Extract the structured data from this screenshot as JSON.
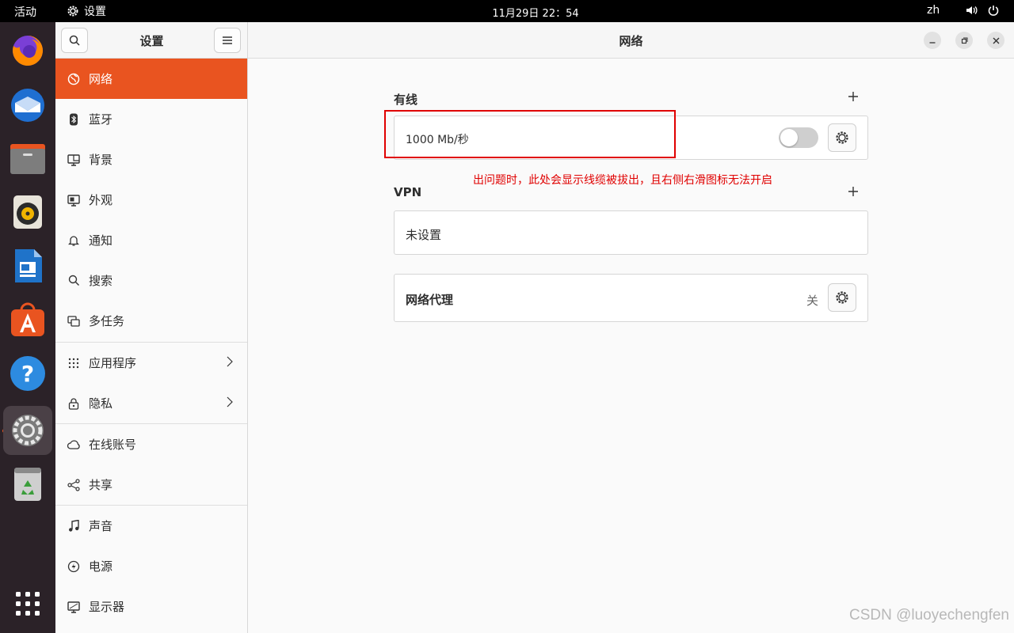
{
  "topbar": {
    "activities": "活动",
    "app_name": "设置",
    "clock": "11月29日  22：54",
    "language": "zh"
  },
  "dock": {
    "apps": [
      "firefox-icon",
      "thunderbird-icon",
      "files-icon",
      "rhythmbox-icon",
      "libreoffice-writer-icon",
      "app-center-icon",
      "help-icon",
      "settings-icon",
      "trash-icon",
      "show-apps-icon"
    ]
  },
  "sidebar": {
    "title": "设置",
    "items": [
      {
        "label": "网络",
        "icon": "network-icon"
      },
      {
        "label": "蓝牙",
        "icon": "bluetooth-icon"
      },
      {
        "label": "背景",
        "icon": "background-icon"
      },
      {
        "label": "外观",
        "icon": "appearance-icon"
      },
      {
        "label": "通知",
        "icon": "bell-icon"
      },
      {
        "label": "搜索",
        "icon": "search-icon"
      },
      {
        "label": "多任务",
        "icon": "multitasking-icon"
      },
      {
        "label": "应用程序",
        "icon": "apps-grid-icon"
      },
      {
        "label": "隐私",
        "icon": "lock-icon"
      },
      {
        "label": "在线账号",
        "icon": "cloud-icon"
      },
      {
        "label": "共享",
        "icon": "share-icon"
      },
      {
        "label": "声音",
        "icon": "music-note-icon"
      },
      {
        "label": "电源",
        "icon": "power-icon"
      },
      {
        "label": "显示器",
        "icon": "display-icon"
      }
    ]
  },
  "main": {
    "title": "网络",
    "wired": {
      "title": "有线",
      "connection_label": "1000 Mb/秒",
      "toggle_on": false
    },
    "vpn": {
      "title": "VPN",
      "status": "未设置"
    },
    "proxy": {
      "label": "网络代理",
      "status": "关"
    }
  },
  "annotation": {
    "text": "出问题时，此处会显示线缆被拔出，且右侧右滑图标无法开启",
    "color": "#e00000"
  },
  "watermark": "CSDN @luoyechengfen",
  "colors": {
    "accent": "#e95420",
    "dock_bg": "#2b2228",
    "topbar_bg": "#000000"
  }
}
